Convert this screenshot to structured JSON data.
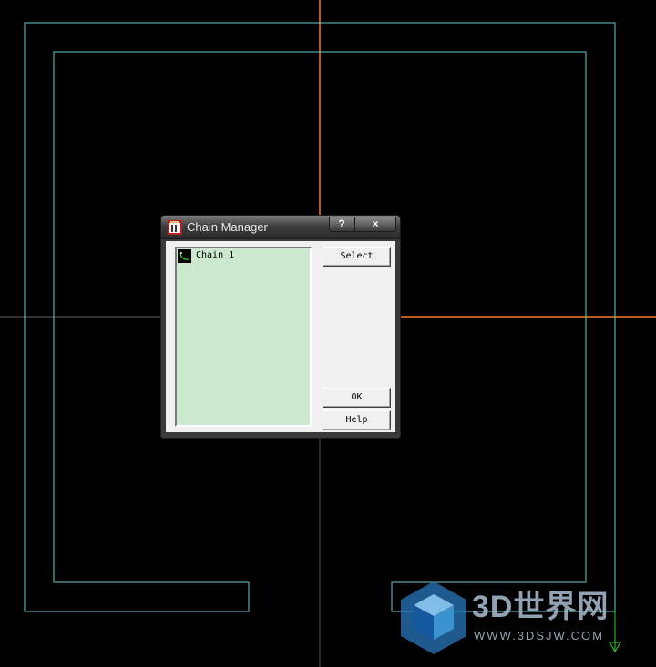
{
  "colors": {
    "background": "#000000",
    "geometry": "#66cccc",
    "axis_x": "#b85c1e",
    "axis_y": "#b85c1e",
    "chain_arrow": "#2bd12b",
    "list_bg": "#cce8cf"
  },
  "dialog": {
    "title": "Chain Manager",
    "help_glyph": "?",
    "close_glyph": "×",
    "app_icon": "chain-manager-app-icon",
    "list": {
      "items": [
        {
          "label": "Chain 1",
          "icon": "chain-icon"
        }
      ]
    },
    "buttons": {
      "select": "Select",
      "ok": "OK",
      "help": "Help"
    }
  },
  "watermark": {
    "brand": "3D世界网",
    "url": "WWW.3DSJW.COM",
    "logo": "cube-logo-icon"
  }
}
